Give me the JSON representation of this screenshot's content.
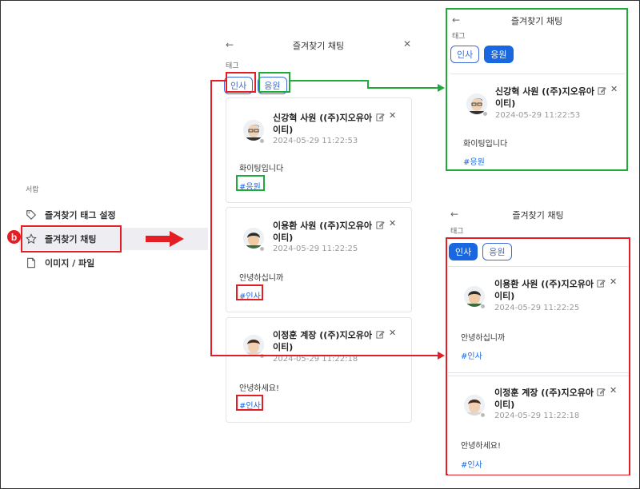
{
  "sidebar": {
    "section_label": "서랍",
    "items": [
      {
        "label": "즐겨찾기 태그 설정",
        "icon": "tag-icon"
      },
      {
        "label": "즐겨찾기 채팅",
        "icon": "star-icon"
      },
      {
        "label": "이미지 / 파일",
        "icon": "file-icon"
      }
    ],
    "step_badge": "b"
  },
  "panel_main": {
    "title": "즐겨찾기 채팅",
    "tags_label": "태그",
    "tags": [
      "인사",
      "응원"
    ],
    "cards": [
      {
        "name_line1": "신강혁 사원 ((주)지오유아",
        "name_line2": "이티)",
        "time": "2024-05-29 11:22:53",
        "message": "화이팅입니다",
        "hashtag": "#응원"
      },
      {
        "name_line1": "이용환 사원 ((주)지오유아",
        "name_line2": "이티)",
        "time": "2024-05-29 11:22:25",
        "message": "안녕하십니까",
        "hashtag": "#인사"
      },
      {
        "name_line1": "이정훈 계장 ((주)지오유아",
        "name_line2": "이티)",
        "time": "2024-05-29 11:22:18",
        "message": "안녕하세요!",
        "hashtag": "#인사"
      }
    ]
  },
  "panel_top": {
    "title": "즐겨찾기 채팅",
    "tags_label": "태그",
    "tags": [
      "인사",
      "응원"
    ],
    "active_tag": "응원",
    "cards": [
      {
        "name_line1": "신강혁 사원 ((주)지오유아",
        "name_line2": "이티)",
        "time": "2024-05-29 11:22:53",
        "message": "화이팅입니다",
        "hashtag": "#응원"
      }
    ]
  },
  "panel_bottom": {
    "title": "즐겨찾기 채팅",
    "tags_label": "태그",
    "tags": [
      "인사",
      "응원"
    ],
    "active_tag": "인사",
    "cards": [
      {
        "name_line1": "이용환 사원 ((주)지오유아",
        "name_line2": "이티)",
        "time": "2024-05-29 11:22:25",
        "message": "안녕하십니까",
        "hashtag": "#인사"
      },
      {
        "name_line1": "이정훈 계장 ((주)지오유아",
        "name_line2": "이티)",
        "time": "2024-05-29 11:22:18",
        "message": "안녕하세요!",
        "hashtag": "#인사"
      }
    ]
  },
  "colors": {
    "highlight_red": "#e31e24",
    "highlight_green": "#1faa3a",
    "accent_blue": "#1a68e0"
  }
}
